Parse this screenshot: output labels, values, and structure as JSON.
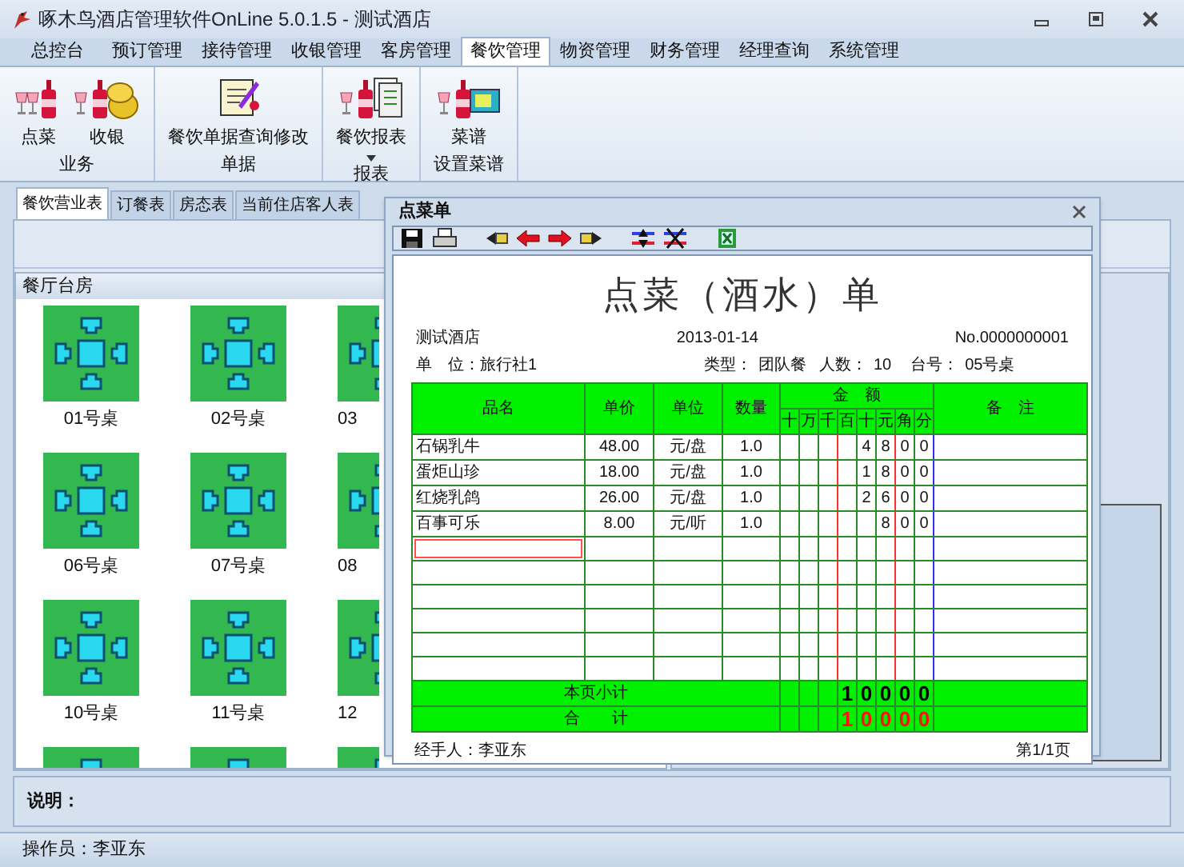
{
  "window": {
    "title": "啄木鸟酒店管理软件OnLine 5.0.1.5 - 测试酒店"
  },
  "menu_tabs": [
    {
      "label": "总控台",
      "selected": false
    },
    {
      "label": "预订管理",
      "selected": false
    },
    {
      "label": "接待管理",
      "selected": false
    },
    {
      "label": "收银管理",
      "selected": false
    },
    {
      "label": "客房管理",
      "selected": false
    },
    {
      "label": "餐饮管理",
      "selected": true
    },
    {
      "label": "物资管理",
      "selected": false
    },
    {
      "label": "财务管理",
      "selected": false
    },
    {
      "label": "经理查询",
      "selected": false
    },
    {
      "label": "系统管理",
      "selected": false
    }
  ],
  "ribbon_groups": [
    {
      "label": "业务",
      "buttons": [
        {
          "label": "点菜",
          "kind": "wine",
          "dropdown": false
        },
        {
          "label": "收银",
          "kind": "coins",
          "dropdown": false
        }
      ]
    },
    {
      "label": "单据",
      "buttons": [
        {
          "label": "餐饮单据查询修改",
          "kind": "document",
          "dropdown": false
        }
      ]
    },
    {
      "label": "报表",
      "buttons": [
        {
          "label": "餐饮报表",
          "kind": "report",
          "dropdown": true
        }
      ]
    },
    {
      "label": "设置菜谱",
      "buttons": [
        {
          "label": "菜谱",
          "kind": "menu",
          "dropdown": false
        }
      ]
    }
  ],
  "tabs": [
    {
      "label": "餐饮营业表",
      "selected": true
    },
    {
      "label": "订餐表",
      "selected": false
    },
    {
      "label": "房态表",
      "selected": false
    },
    {
      "label": "当前住店客人表",
      "selected": false
    }
  ],
  "dining_room": {
    "title": "餐厅台房",
    "tables": [
      {
        "label": "01号桌"
      },
      {
        "label": "02号桌"
      },
      {
        "label": "03"
      },
      {
        "label": "06号桌"
      },
      {
        "label": "07号桌"
      },
      {
        "label": "08"
      },
      {
        "label": "10号桌"
      },
      {
        "label": "11号桌"
      },
      {
        "label": "12"
      }
    ]
  },
  "note": {
    "label": "说明："
  },
  "status_bar": {
    "operator": "操作员：李亚东"
  },
  "order_dialog": {
    "title": "点菜单",
    "report": {
      "title": "点菜（酒水）单",
      "hotel": "测试酒店",
      "date": "2013-01-14",
      "number": "No.0000000001",
      "unit": "单　位：旅行社1",
      "type_label": "类型：",
      "type": "团队餐",
      "guests_label": "人数：",
      "guests": "10",
      "table_label": "台号：",
      "table": "05号桌",
      "columns": [
        "品名",
        "单价",
        "单位",
        "数量"
      ],
      "amount_header": "金　额",
      "digit_headers": [
        "十",
        "万",
        "千",
        "百",
        "十",
        "元",
        "角",
        "分"
      ],
      "remark_header": "备　注",
      "rows": [
        {
          "name": "石锅乳牛",
          "price": "48.00",
          "unit": "元/盘",
          "qty": "1.0",
          "digits": [
            "4",
            "8",
            "0",
            "0"
          ]
        },
        {
          "name": "蛋炬山珍",
          "price": "18.00",
          "unit": "元/盘",
          "qty": "1.0",
          "digits": [
            "1",
            "8",
            "0",
            "0"
          ]
        },
        {
          "name": "红烧乳鸽",
          "price": "26.00",
          "unit": "元/盘",
          "qty": "1.0",
          "digits": [
            "2",
            "6",
            "0",
            "0"
          ]
        },
        {
          "name": "百事可乐",
          "price": "8.00",
          "unit": "元/听",
          "qty": "1.0",
          "digits": [
            "8",
            "0",
            "0"
          ]
        }
      ],
      "entry_focused": true,
      "totals": [
        {
          "kind": "subtotal",
          "label": "本页小计",
          "digits": [
            "1",
            "0",
            "0",
            "0",
            "0"
          ]
        },
        {
          "kind": "total",
          "label": "合　　计",
          "digits": [
            "1",
            "0",
            "0",
            "0",
            "0"
          ]
        }
      ],
      "handler": "经手人：李亚东",
      "page": "第1/1页"
    }
  }
}
